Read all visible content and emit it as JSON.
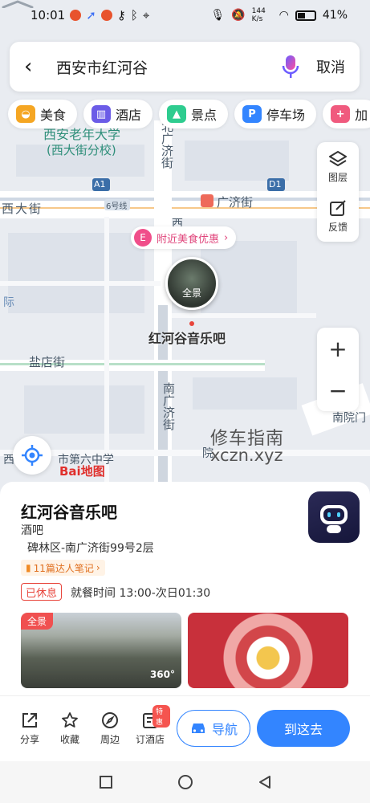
{
  "status": {
    "time": "10:01",
    "network_speed": "144 K/s",
    "battery": "41%"
  },
  "search": {
    "query": "西安市红河谷",
    "cancel": "取消"
  },
  "chips": [
    {
      "label": "美食",
      "icon": "food-icon",
      "color": "#f5a623"
    },
    {
      "label": "酒店",
      "icon": "hotel-icon",
      "color": "#6c5ce7"
    },
    {
      "label": "景点",
      "icon": "scenic-icon",
      "color": "#2ecc8f"
    },
    {
      "label": "停车场",
      "icon": "parking-icon",
      "color": "#3385ff"
    },
    {
      "label": "加",
      "icon": "more-icon",
      "color": "#f05a7e"
    }
  ],
  "tools": {
    "layers": "图层",
    "feedback": "反馈"
  },
  "map": {
    "labels": {
      "school1": "西安老年大学",
      "school2": "(西大街分校)",
      "north_street": "北广济街",
      "west_street": "西大街",
      "line6": "6号线",
      "exit_a1": "A1",
      "exit_d1": "D1",
      "guangji": "广济街",
      "xi": "西",
      "jian": "际",
      "yandian": "盐店街",
      "south_street": "南广济街",
      "nanyuan": "南院门",
      "yuan": "院",
      "west_bottom": "西",
      "school_bottom": "市第六中学"
    },
    "promo": "附近美食优惠",
    "pano": "全景",
    "poi_name": "红河谷音乐吧",
    "baidu": "Bai地图",
    "watermark_cn": "修车指南",
    "watermark_en": "xczn.xyz"
  },
  "place": {
    "name": "红河谷音乐吧",
    "category": "酒吧",
    "address": "碑林区-南广济街99号2层",
    "notes": "11篇达人笔记",
    "status": "已休息",
    "hours": "就餐时间 13:00-次日01:30",
    "photo_tag": "全景",
    "photo_deg": "360°"
  },
  "actions": {
    "share": "分享",
    "favorite": "收藏",
    "nearby": "周边",
    "book_hotel": "订酒店",
    "book_badge": "特惠",
    "navigate": "导航",
    "go_here": "到这去"
  },
  "colors": {
    "accent": "#3385ff",
    "closed": "#e8453c",
    "notes": "#e07020"
  }
}
